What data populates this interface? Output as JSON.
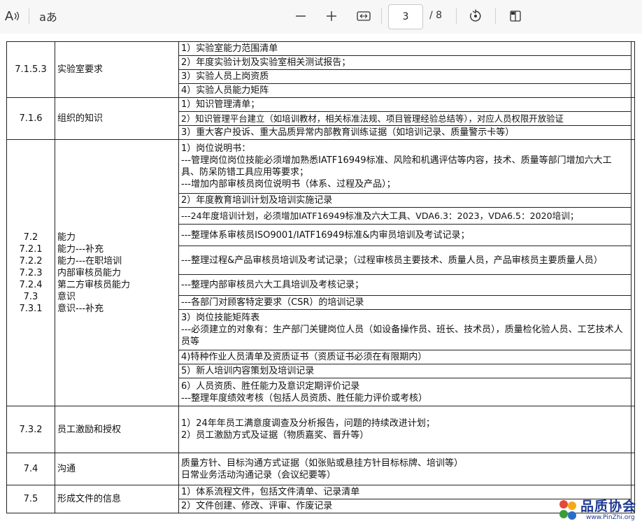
{
  "toolbar": {
    "read_aloud_icon_label": "A",
    "text_options_label": "aあ",
    "page_current": "3",
    "page_total": "/ 8"
  },
  "table": {
    "rows": [
      {
        "clause": "7.1.5.3",
        "name": "实验室要求",
        "items": [
          "1）实验室能力范围清单",
          "2）年度实验计划及实验室相关测试报告；",
          "3）实验人员上岗资质",
          "4）实验人员能力矩阵"
        ]
      },
      {
        "clause": "7.1.6",
        "name": "组织的知识",
        "items": [
          "1）知识管理清单；",
          "2）知识管理平台建立（如培训教材，相关标准法规、项目管理经验总结等），对应人员权限开放验证",
          "3）重大客户投诉、重大品质异常内部教育训练证据（如培训记录、质量警示卡等）"
        ]
      },
      {
        "clause_lines": [
          "7.2",
          "7.2.1",
          "7.2.2",
          "7.2.3",
          "7.2.4",
          "7.3",
          "7.3.1"
        ],
        "name_lines": [
          "能力",
          "能力---补充",
          "能力---在职培训",
          "内部审核员能力",
          "第二方审核员能力",
          "意识",
          "意识---补充"
        ],
        "items": [
          [
            "1）岗位说明书：",
            "---管理岗位岗位技能必须增加熟悉IATF16949标准、风险和机遇评估等内容，技术、质量等部门增加六大工具、防呆防错工具应用等要求；",
            "---增加内部审核员岗位说明书（体系、过程及产品）；"
          ],
          [
            "2）年度教育培训计划及培训实施记录"
          ],
          [
            "---24年度培训计划，必须增加IATF16949标准及六大工具、VDA6.3：2023，VDA6.5：2020培训；"
          ],
          [
            "---整理体系审核员ISO9001/IATF16949标准&内审员培训及考试记录；"
          ],
          [
            "---整理过程&产品审核员培训及考试记录；（过程审核员主要技术、质量人员，产品审核员主要质量人员）"
          ],
          [
            "---整理内部审核员六大工具培训及考核记录；"
          ],
          [
            "---各部门对顾客特定要求（CSR）的培训记录"
          ],
          [
            "3）岗位技能矩阵表",
            "---必须建立的对象有：生产部门关键岗位人员（如设备操作员、班长、技术员），质量检化验人员、工艺技术人员等"
          ],
          [
            "4)特种作业人员清单及资质证书（资质证书必须在有限期内）"
          ],
          [
            "5）新人培训内容策划及培训记录"
          ],
          [
            "6）人员资质、胜任能力及意识定期评价记录",
            "---整理年度绩效考核（包括人员资质、胜任能力评价或考核）"
          ]
        ]
      },
      {
        "clause": "7.3.2",
        "name": "员工激励和授权",
        "items": [
          [
            "1）24年年员工满意度调查及分析报告，问题的持续改进计划；",
            "2）员工激励方式及证据（物质嘉奖、晋升等）"
          ]
        ]
      },
      {
        "clause": "7.4",
        "name": "沟通",
        "items": [
          [
            "质量方针、目标沟通方式证据（如张贴或悬挂方针目标标牌、培训等）",
            "日常业务活动沟通记录（会议纪要等）"
          ]
        ]
      },
      {
        "clause": "7.5",
        "name": "形成文件的信息",
        "items": [
          "1）体系流程文件，包括文件清单、记录清单",
          "2）文件创建、修改、评审、作废记录"
        ]
      }
    ]
  },
  "watermark": {
    "title": "品质协会",
    "url": "www.PinZhi.org"
  },
  "icons": [
    "read-aloud-icon",
    "text-options-icon",
    "zoom-out-icon",
    "zoom-in-icon",
    "fit-width-icon",
    "rotate-icon",
    "page-view-icon",
    "watermark-logo-icon"
  ]
}
